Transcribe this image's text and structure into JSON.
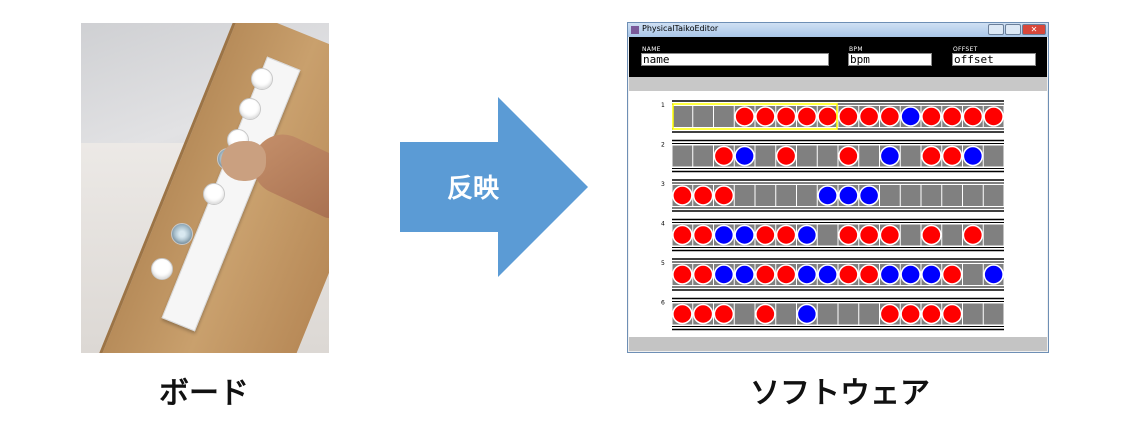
{
  "arrow_label": "反映",
  "captions": {
    "board": "ボード",
    "software": "ソフトウェア"
  },
  "window": {
    "title": "PhysicalTaikoEditor",
    "fields": [
      {
        "label": "NAME",
        "value": "name"
      },
      {
        "label": "BPM",
        "value": "bpm"
      },
      {
        "label": "OFFSET",
        "value": "offset"
      }
    ]
  },
  "measures": [
    {
      "number": "1",
      "notes": [
        "",
        "",
        "",
        "red",
        "red",
        "red",
        "red",
        "red",
        "red",
        "red",
        "red",
        "blue",
        "red",
        "red",
        "red",
        "red"
      ]
    },
    {
      "number": "2",
      "notes": [
        "",
        "",
        "red",
        "blue",
        "",
        "red",
        "",
        "",
        "red",
        "",
        "blue",
        "",
        "red",
        "red",
        "blue",
        ""
      ]
    },
    {
      "number": "3",
      "notes": [
        "red",
        "red",
        "red",
        "",
        "",
        "",
        "",
        "blue",
        "blue",
        "blue",
        "",
        "",
        "",
        "",
        "",
        ""
      ]
    },
    {
      "number": "4",
      "notes": [
        "red",
        "red",
        "blue",
        "blue",
        "red",
        "red",
        "blue",
        "",
        "red",
        "red",
        "red",
        "",
        "red",
        "",
        "red",
        ""
      ]
    },
    {
      "number": "5",
      "notes": [
        "red",
        "red",
        "blue",
        "blue",
        "red",
        "red",
        "blue",
        "blue",
        "red",
        "red",
        "blue",
        "blue",
        "blue",
        "red",
        "",
        "blue"
      ]
    },
    {
      "number": "6",
      "notes": [
        "red",
        "red",
        "red",
        "",
        "red",
        "",
        "blue",
        "",
        "",
        "",
        "red",
        "red",
        "red",
        "red",
        "",
        ""
      ]
    }
  ],
  "colors": {
    "arrow": "#5b9bd5",
    "don": "#ff0000",
    "ka": "#0000ff",
    "lane": "#808080",
    "selection": "#ffff00"
  }
}
